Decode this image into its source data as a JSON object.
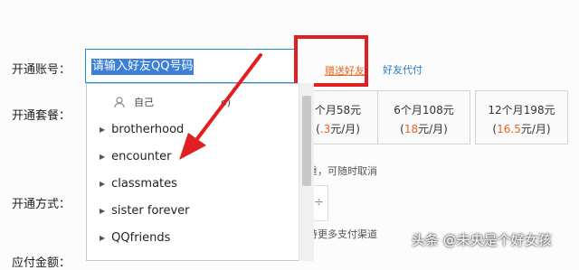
{
  "form": {
    "account_label": "开通账号：",
    "package_label": "开通套餐：",
    "method_label": "开通方式：",
    "amount_label": "应付金额："
  },
  "account_input": {
    "placeholder": "请输入好友QQ号码"
  },
  "links": {
    "gift_friend": "赠送好友",
    "friend_proxy": "好友代付"
  },
  "packages": [
    {
      "title": "个月58元",
      "price_prefix": "(",
      "price_value": ".3",
      "price_suffix": "元/月)"
    },
    {
      "title": "6个月108元",
      "price_prefix": "(",
      "price_value": "18",
      "price_suffix": "元/月)"
    },
    {
      "title": "12个月198元",
      "price_prefix": "(",
      "price_value": "16.5",
      "price_suffix": "元/月)"
    }
  ],
  "dropdown": {
    "self_label": "自己",
    "self_suffix": "o)",
    "groups": [
      "brotherhood",
      "encounter",
      "classmates",
      "sister forever",
      "QQfriends"
    ]
  },
  "notes": {
    "cancel_note": "重，可随时取消",
    "payment_note": "持更多支付渠道",
    "stepper_symbol": "÷"
  },
  "colors": {
    "annotation_red": "#e02020",
    "input_border": "#1d8fe1",
    "accent_orange": "#e8641c",
    "link_blue": "#2a7ac5"
  },
  "watermark": "头条 @未央是个好女孩"
}
